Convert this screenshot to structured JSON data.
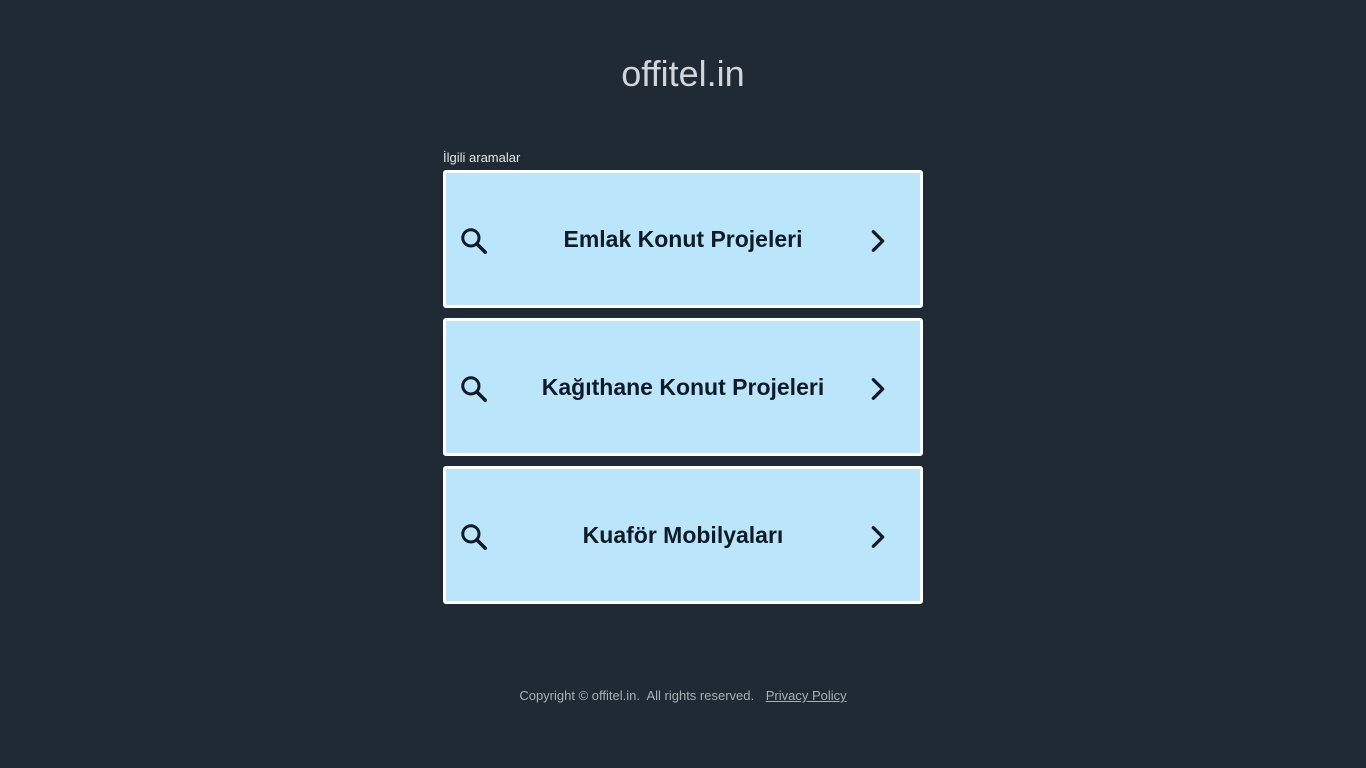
{
  "header": {
    "title": "offitel.in"
  },
  "related": {
    "label": "İlgili aramalar",
    "items": [
      {
        "label": "Emlak Konut Projeleri"
      },
      {
        "label": "Kağıthane Konut Projeleri"
      },
      {
        "label": "Kuaför Mobilyaları"
      }
    ]
  },
  "icons": {
    "search": "search-icon",
    "chevron": "chevron-right-icon"
  },
  "footer": {
    "copyright": "Copyright © offitel.in.  All rights reserved.",
    "privacy_label": "Privacy Policy"
  },
  "colors": {
    "background": "#1f2a34",
    "card": "#bbe5fa",
    "card_border": "#ffffff",
    "title_text": "#d2d6da",
    "card_text": "#0f1b26"
  }
}
